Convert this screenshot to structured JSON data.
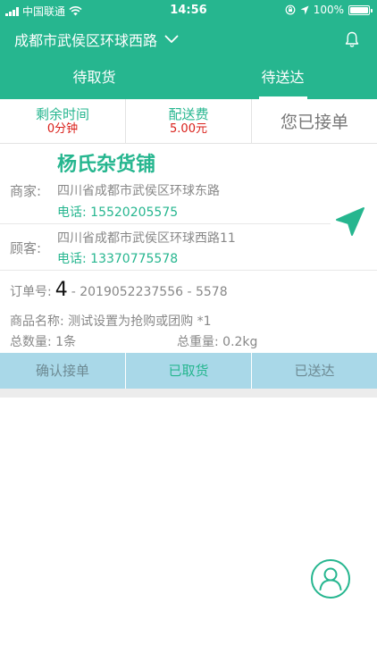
{
  "status_bar": {
    "carrier": "中国联通",
    "time": "14:56",
    "battery": "100%"
  },
  "header": {
    "location": "成都市武侯区环球西路"
  },
  "tabs": [
    {
      "label": "待取货"
    },
    {
      "label": "待送达"
    }
  ],
  "summary": {
    "time_label": "剩余时间",
    "time_value": "0分钟",
    "fee_label": "配送费",
    "fee_value": "5.00元",
    "accepted": "您已接单"
  },
  "order": {
    "shop_name": "杨氏杂货铺",
    "merchant_label": "商家:",
    "merchant_address": "四川省成都市武侯区环球东路",
    "merchant_phone": "电话: 15520205575",
    "customer_label": "顾客:",
    "customer_address": "四川省成都市武侯区环球西路11",
    "customer_phone": "电话: 13370775578",
    "number_label": "订单号:",
    "number": "4",
    "number_suffix": "- 2019052237556 - 5578",
    "goods": "商品名称: 测试设置为抢购或团购 *1",
    "total_count": "总数量: 1条",
    "total_weight": "总重量: 0.2kg"
  },
  "actions": {
    "confirm": "确认接单",
    "picked": "已取货",
    "delivered": "已送达"
  },
  "colors": {
    "brand": "#26b68f",
    "price": "#d9201a",
    "action_bar": "#a9d8e8"
  },
  "icons": {
    "bell": "bell-icon",
    "navigate": "navigation-arrow-icon",
    "profile": "user-profile-icon",
    "dropdown": "chevron-down-icon"
  }
}
